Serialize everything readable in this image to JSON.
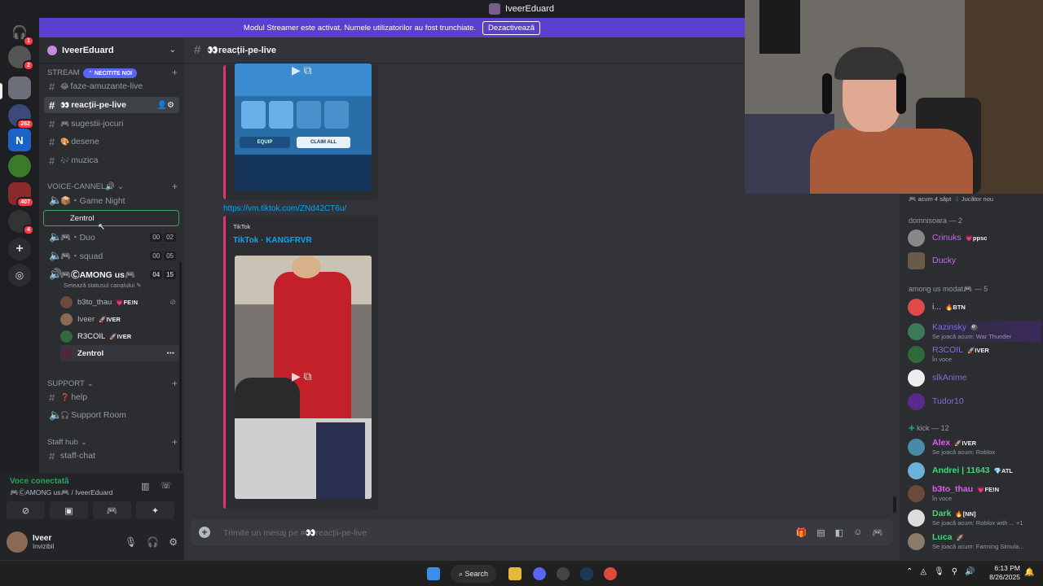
{
  "window": {
    "title": "IveerEduard"
  },
  "banner": {
    "text": "Modul Streamer este activat. Numele utilizatorilor au fost trunchiate.",
    "button": "Dezactivează"
  },
  "servers": {
    "badges": [
      "1",
      "2",
      "262",
      "407",
      "4"
    ],
    "logo_letter": "N"
  },
  "guild": {
    "name": "IveerEduard"
  },
  "channels": {
    "unread_pill": "NECITITE NOI",
    "stream_category": "STREAM",
    "stream": [
      {
        "emoji": "😂",
        "name": "faze-amuzante-live"
      },
      {
        "emoji": "👀",
        "name": "reacții-pe-live"
      },
      {
        "emoji": "🎮",
        "name": "sugestii-jocuri"
      },
      {
        "emoji": "🎨",
        "name": "desene"
      },
      {
        "emoji": "🎶",
        "name": "muzica"
      }
    ],
    "voice_category": "VOICE-CANNEL🔊",
    "voice": [
      {
        "name": "📦・Game Night"
      },
      {
        "name": "🎮・Duo",
        "count_a": "00",
        "count_b": "02"
      },
      {
        "name": "🎮・squad",
        "count_a": "00",
        "count_b": "05"
      },
      {
        "name": "🎮ⒸAMONG us🎮",
        "count_a": "04",
        "count_b": "15"
      }
    ],
    "voice_status": "Setează statusul canalului",
    "voice_users": [
      {
        "name": "b3to_thau",
        "tag": "💗FE!N"
      },
      {
        "name": "Iveer",
        "tag": "🚀IVER"
      },
      {
        "name": "R3COIL",
        "tag": "🚀IVER"
      },
      {
        "name": "Zentrol",
        "tag": ""
      }
    ],
    "drag_ghost": "Zentrol",
    "support_category": "SUPPORT",
    "support": [
      {
        "emoji": "❓",
        "name": "help"
      },
      {
        "emoji": "🎧",
        "name": "Support Room"
      }
    ],
    "staff_category": "Staff hub",
    "staff": [
      {
        "name": "staff-chat"
      }
    ]
  },
  "voice_panel": {
    "status": "Voce conectată",
    "channel": "🎮ⒸAMONG us🎮 / IveerEduard"
  },
  "user_panel": {
    "name": "Iveer",
    "status": "Invizibil"
  },
  "chat": {
    "channel": "👀reacții-pe-live",
    "game_buttons": [
      "EQUIP",
      "CLAIM ALL"
    ],
    "link": "https://vm.tiktok.com/ZNd42CT6u/",
    "embed_provider": "TikTok",
    "embed_title": "TikTok · KANGFRVR",
    "placeholder": "Trimite un mesaj pe #👀reacții-pe-live"
  },
  "members": {
    "top_row": {
      "time": "acum 4 săpt",
      "label": "Jucător nou"
    },
    "groups": [
      {
        "title": "domnisoara — 2",
        "members": [
          {
            "name": "Crinuks",
            "tag": "💗ppsc",
            "color": "#c46be8"
          },
          {
            "name": "Ducky",
            "tag": "",
            "color": "#c46be8"
          }
        ]
      },
      {
        "title": "among us modat🎮 — 5",
        "members": [
          {
            "name": "i...",
            "tag": "🔥BTN",
            "color": "#d0a3ff"
          },
          {
            "name": "Kazinsky",
            "tag": "🎱",
            "activity": "Se joacă acum: War Thunder",
            "color": "#7e6fd8"
          },
          {
            "name": "R3COIL",
            "tag": "🚀IVER",
            "activity": "În voce",
            "color": "#7e6fd8"
          },
          {
            "name": "slkAnime",
            "tag": "",
            "color": "#7e6fd8"
          },
          {
            "name": "Tudor10",
            "tag": "",
            "color": "#7e6fd8"
          }
        ]
      },
      {
        "title": "kick — 12",
        "members": [
          {
            "name": "Alex",
            "tag": "🚀IVER",
            "activity": "Se joacă acum: Roblox",
            "color": "#e35cf5"
          },
          {
            "name": "Andrei | 11643",
            "tag": "💎ATL",
            "color": "#40d67a"
          },
          {
            "name": "b3to_thau",
            "tag": "💗FE!N",
            "activity": "În voce",
            "color": "#e35cf5"
          },
          {
            "name": "Dark",
            "tag": "🔥[NN]",
            "activity": "Se joacă acum: Roblox with ...",
            "extra": "+1",
            "color": "#40d67a"
          },
          {
            "name": "Luca",
            "tag": "🚀",
            "activity": "Se joacă acum: Farming Simula...",
            "color": "#40d67a"
          }
        ]
      }
    ]
  },
  "taskbar": {
    "search": "Search",
    "time": "6:13 PM",
    "date": "8/26/2025"
  }
}
